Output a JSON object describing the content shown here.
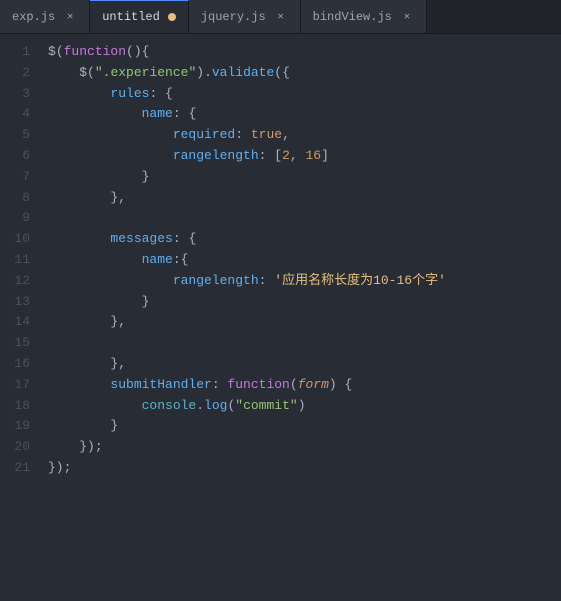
{
  "tabs": [
    {
      "id": "exp-js",
      "label": "exp.js",
      "active": false,
      "modified": false,
      "closeable": true
    },
    {
      "id": "untitled",
      "label": "untitled",
      "active": true,
      "modified": true,
      "closeable": false
    },
    {
      "id": "jquery-js",
      "label": "jquery.js",
      "active": false,
      "modified": false,
      "closeable": true
    },
    {
      "id": "bindview-js",
      "label": "bindView.js",
      "active": false,
      "modified": false,
      "closeable": true
    }
  ],
  "code": {
    "lines": [
      {
        "num": 1,
        "content": "$(function(){"
      },
      {
        "num": 2,
        "content": "    $(\".experience\").validate({"
      },
      {
        "num": 3,
        "content": "        rules: {"
      },
      {
        "num": 4,
        "content": "            name: {"
      },
      {
        "num": 5,
        "content": "                required: true,"
      },
      {
        "num": 6,
        "content": "                rangelength: [2, 16]"
      },
      {
        "num": 7,
        "content": "            }"
      },
      {
        "num": 8,
        "content": "        },"
      },
      {
        "num": 9,
        "content": ""
      },
      {
        "num": 10,
        "content": "        messages: {"
      },
      {
        "num": 11,
        "content": "            name:{"
      },
      {
        "num": 12,
        "content": "                rangelength: '应用名称长度为10-16个字'"
      },
      {
        "num": 13,
        "content": "            }"
      },
      {
        "num": 14,
        "content": "        },"
      },
      {
        "num": 15,
        "content": ""
      },
      {
        "num": 16,
        "content": "        },"
      },
      {
        "num": 17,
        "content": "        submitHandler: function(form) {"
      },
      {
        "num": 18,
        "content": "            console.log(\"commit\")"
      },
      {
        "num": 19,
        "content": "        }"
      },
      {
        "num": 20,
        "content": "    });"
      },
      {
        "num": 21,
        "content": "});"
      }
    ]
  }
}
